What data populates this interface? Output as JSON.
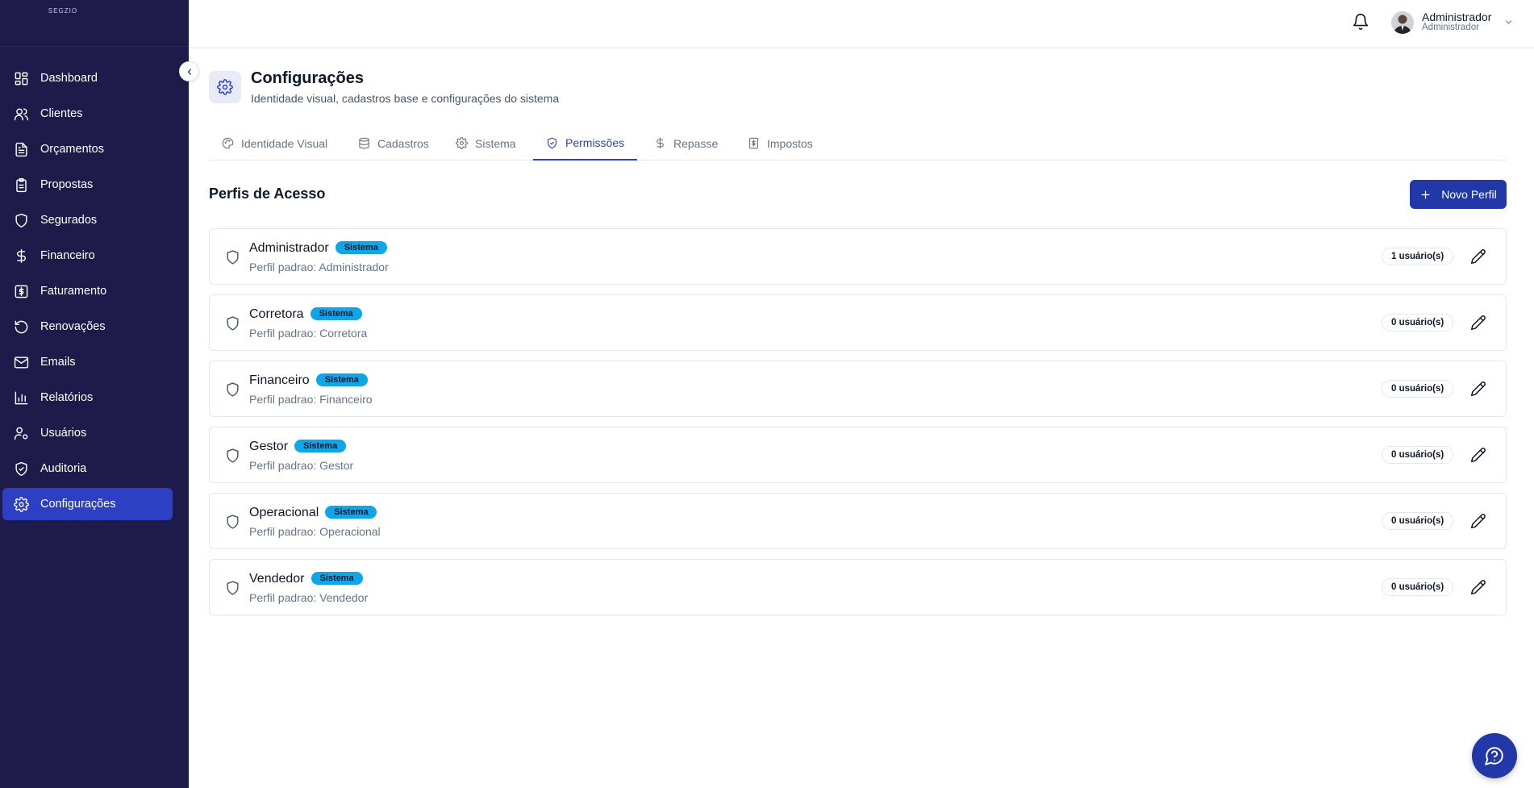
{
  "brand": {
    "logo_text": "SEGZIO"
  },
  "colors": {
    "sidebar_bg": "#1e1b4b",
    "accent": "#2d3fc2",
    "primary_button": "#2238a8",
    "badge": "#0ea5e9"
  },
  "sidebar": {
    "items": [
      {
        "label": "Dashboard",
        "icon": "dashboard-icon"
      },
      {
        "label": "Clientes",
        "icon": "users-icon"
      },
      {
        "label": "Orçamentos",
        "icon": "document-icon"
      },
      {
        "label": "Propostas",
        "icon": "clipboard-icon"
      },
      {
        "label": "Segurados",
        "icon": "shield-icon"
      },
      {
        "label": "Financeiro",
        "icon": "dollar-icon"
      },
      {
        "label": "Faturamento",
        "icon": "receipt-icon"
      },
      {
        "label": "Renovações",
        "icon": "rotate-icon"
      },
      {
        "label": "Emails",
        "icon": "mail-icon"
      },
      {
        "label": "Relatórios",
        "icon": "bar-chart-icon"
      },
      {
        "label": "Usuários",
        "icon": "user-cog-icon"
      },
      {
        "label": "Auditoria",
        "icon": "shield-check-icon"
      },
      {
        "label": "Configurações",
        "icon": "gear-icon",
        "active": true
      }
    ]
  },
  "header": {
    "user_name": "Administrador",
    "user_role": "Administrador"
  },
  "page": {
    "title": "Configurações",
    "subtitle": "Identidade visual, cadastros base e configurações do sistema"
  },
  "tabs": [
    {
      "label": "Identidade Visual",
      "icon": "palette-icon"
    },
    {
      "label": "Cadastros",
      "icon": "database-icon"
    },
    {
      "label": "Sistema",
      "icon": "gear-icon"
    },
    {
      "label": "Permissões",
      "icon": "shield-check-icon",
      "active": true
    },
    {
      "label": "Repasse",
      "icon": "dollar-icon"
    },
    {
      "label": "Impostos",
      "icon": "receipt-icon"
    }
  ],
  "section": {
    "title": "Perfis de Acesso",
    "new_button": "Novo Perfil"
  },
  "profiles": [
    {
      "name": "Administrador",
      "badge": "Sistema",
      "description": "Perfil padrao: Administrador",
      "users": "1 usuário(s)"
    },
    {
      "name": "Corretora",
      "badge": "Sistema",
      "description": "Perfil padrao: Corretora",
      "users": "0 usuário(s)"
    },
    {
      "name": "Financeiro",
      "badge": "Sistema",
      "description": "Perfil padrao: Financeiro",
      "users": "0 usuário(s)"
    },
    {
      "name": "Gestor",
      "badge": "Sistema",
      "description": "Perfil padrao: Gestor",
      "users": "0 usuário(s)"
    },
    {
      "name": "Operacional",
      "badge": "Sistema",
      "description": "Perfil padrao: Operacional",
      "users": "0 usuário(s)"
    },
    {
      "name": "Vendedor",
      "badge": "Sistema",
      "description": "Perfil padrao: Vendedor",
      "users": "0 usuário(s)"
    }
  ]
}
